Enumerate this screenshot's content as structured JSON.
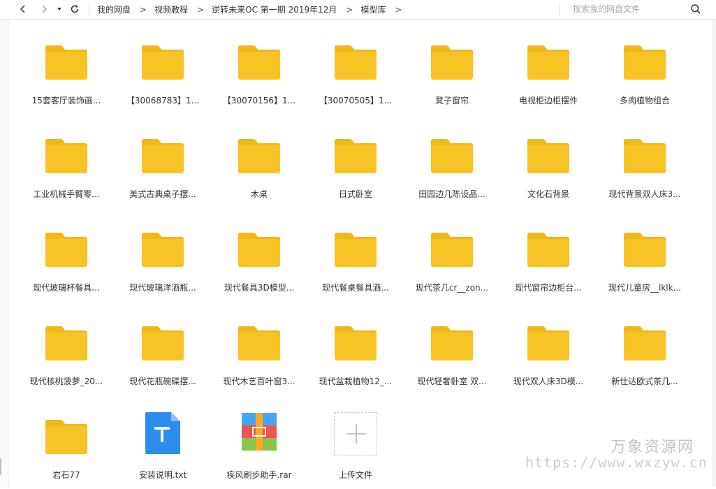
{
  "toolbar": {
    "breadcrumbs": [
      "我的网盘",
      "视频教程",
      "逆转未来OC 第一期 2019年12月",
      "模型库"
    ],
    "separator": ">",
    "search_placeholder": "搜索我的网盘文件"
  },
  "colors": {
    "folder": "#f7c325",
    "folder_tab": "#f2b719",
    "txt_icon": "#2d8cf0",
    "rar_red": "#ef5350",
    "rar_green": "#8bc34a",
    "rar_blue": "#42a5f5",
    "rar_orange": "#ffa726"
  },
  "items": [
    {
      "type": "folder",
      "icon": "folder-icon",
      "name": "15套客厅装饰画..."
    },
    {
      "type": "folder",
      "icon": "folder-icon",
      "name": "【30068783】1..."
    },
    {
      "type": "folder",
      "icon": "folder-icon",
      "name": "【30070156】1..."
    },
    {
      "type": "folder",
      "icon": "folder-icon",
      "name": "【30070505】1..."
    },
    {
      "type": "folder",
      "icon": "folder-icon",
      "name": "凳子窗帘"
    },
    {
      "type": "folder",
      "icon": "folder-icon",
      "name": "电视柜边柜摆件"
    },
    {
      "type": "folder",
      "icon": "folder-icon",
      "name": "多肉植物组合"
    },
    {
      "type": "folder",
      "icon": "folder-icon",
      "name": "工业机械手臂零..."
    },
    {
      "type": "folder",
      "icon": "folder-icon",
      "name": "美式古典桌子摆..."
    },
    {
      "type": "folder",
      "icon": "folder-icon",
      "name": "木桌"
    },
    {
      "type": "folder",
      "icon": "folder-icon",
      "name": "日式卧室"
    },
    {
      "type": "folder",
      "icon": "folder-icon",
      "name": "田园边几陈设品..."
    },
    {
      "type": "folder",
      "icon": "folder-icon",
      "name": "文化石背景"
    },
    {
      "type": "folder",
      "icon": "folder-icon",
      "name": "现代背景双人床3..."
    },
    {
      "type": "folder",
      "icon": "folder-icon",
      "name": "现代玻璃杯餐具..."
    },
    {
      "type": "folder",
      "icon": "folder-icon",
      "name": "现代玻璃洋酒瓶..."
    },
    {
      "type": "folder",
      "icon": "folder-icon",
      "name": "现代餐具3D模型..."
    },
    {
      "type": "folder",
      "icon": "folder-icon",
      "name": "现代餐桌餐具酒..."
    },
    {
      "type": "folder",
      "icon": "folder-icon",
      "name": "现代茶几cr__zon..."
    },
    {
      "type": "folder",
      "icon": "folder-icon",
      "name": "现代窗帘边柜台..."
    },
    {
      "type": "folder",
      "icon": "folder-icon",
      "name": "现代儿童房__lklk..."
    },
    {
      "type": "folder",
      "icon": "folder-icon",
      "name": "现代核桃菠萝_20..."
    },
    {
      "type": "folder",
      "icon": "folder-icon",
      "name": "现代花瓶碗碟摆..."
    },
    {
      "type": "folder",
      "icon": "folder-icon",
      "name": "现代木艺百叶窗3..."
    },
    {
      "type": "folder",
      "icon": "folder-icon",
      "name": "现代盆栽植物12_..."
    },
    {
      "type": "folder",
      "icon": "folder-icon",
      "name": "现代轻奢卧室 双..."
    },
    {
      "type": "folder",
      "icon": "folder-icon",
      "name": "现代双人床3D模..."
    },
    {
      "type": "folder",
      "icon": "folder-icon",
      "name": "新仕达欧式茶几..."
    },
    {
      "type": "folder",
      "icon": "folder-icon",
      "name": "岩石77"
    },
    {
      "type": "txt",
      "icon": "txt-file-icon",
      "name": "安装说明.txt"
    },
    {
      "type": "rar",
      "icon": "rar-archive-icon",
      "name": "疾风刷步助手.rar"
    },
    {
      "type": "upload",
      "icon": "plus-icon",
      "name": "上传文件"
    }
  ],
  "watermark": {
    "title": "万象资源网",
    "url": "https://www.wxzyw.cn"
  }
}
